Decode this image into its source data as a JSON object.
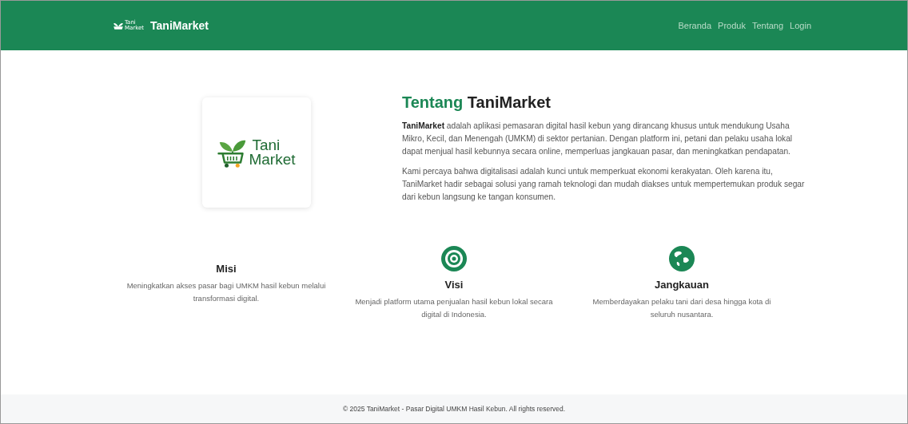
{
  "navbar": {
    "logo_text": [
      "Tani",
      "Market"
    ],
    "brand": "TaniMarket",
    "links": [
      {
        "label": "Beranda"
      },
      {
        "label": "Produk"
      },
      {
        "label": "Tentang"
      },
      {
        "label": "Login"
      }
    ]
  },
  "about": {
    "logo_text": [
      "Tani",
      "Market"
    ],
    "title_accent": "Tentang",
    "title_rest": "TaniMarket",
    "paragraphs": [
      "**TaniMarket** adalah aplikasi pemasaran digital hasil kebun yang dirancang khusus untuk mendukung Usaha Mikro, Kecil, dan Menengah (UMKM) di sektor pertanian. Dengan platform ini, petani dan pelaku usaha lokal dapat menjual hasil kebunnya secara online, memperluas jangkauan pasar, dan meningkatkan pendapatan.",
      "Kami percaya bahwa digitalisasi adalah kunci untuk memperkuat ekonomi kerakyatan. Oleh karena itu, TaniMarket hadir sebagai solusi yang ramah teknologi dan mudah diakses untuk mempertemukan produk segar dari kebun langsung ke tangan konsumen."
    ]
  },
  "features": [
    {
      "kind": "plain",
      "title": "Misi",
      "text": "Meningkatkan akses pasar bagi UMKM hasil kebun melalui transformasi digital."
    },
    {
      "kind": "target",
      "title": "Visi",
      "text": "Menjadi platform utama penjualan hasil kebun lokal secara digital di Indonesia."
    },
    {
      "kind": "globe",
      "title": "Jangkauan",
      "text": "Memberdayakan pelaku tani dari desa hingga kota di seluruh nusantara."
    }
  ],
  "footer": {
    "text": "© 2025 TaniMarket - Pasar Digital UMKM Hasil Kebun. All rights reserved."
  }
}
